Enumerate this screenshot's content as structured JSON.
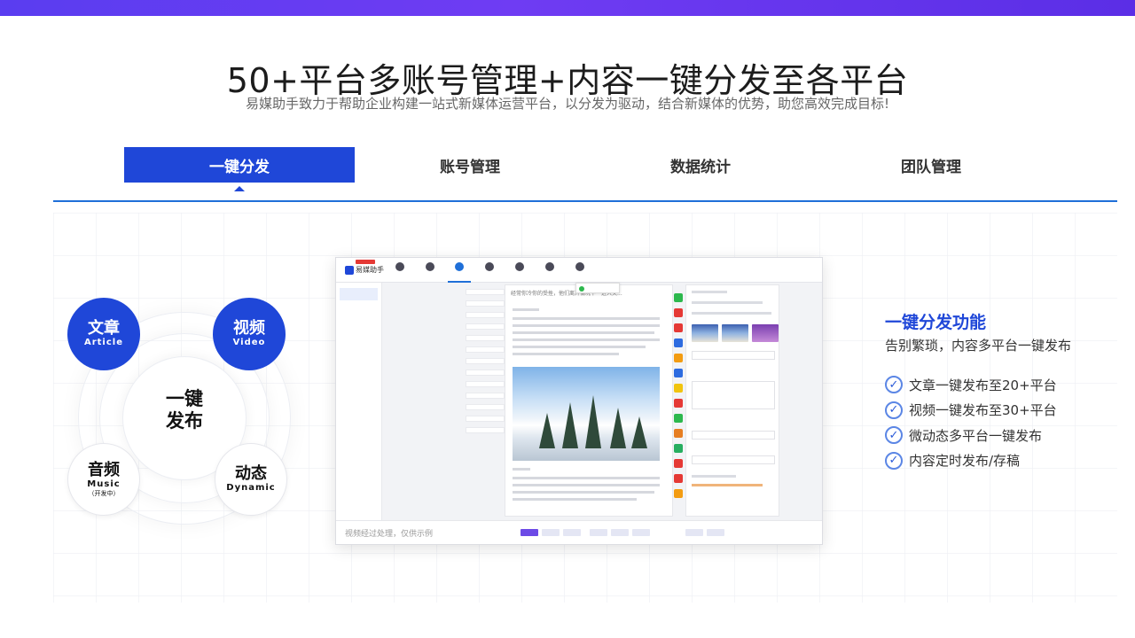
{
  "header": {
    "title": "50+平台多账号管理+内容一键分发至各平台",
    "subtitle": "易媒助手致力于帮助企业构建一站式新媒体运营平台，以分发为驱动，结合新媒体的优势，助您高效完成目标!"
  },
  "tabs": [
    {
      "label": "一键分发",
      "active": true
    },
    {
      "label": "账号管理",
      "active": false
    },
    {
      "label": "数据统计",
      "active": false
    },
    {
      "label": "团队管理",
      "active": false
    }
  ],
  "diagram": {
    "center": [
      "一键",
      "发布"
    ],
    "bubbles": {
      "article": {
        "cn": "文章",
        "en": "Article"
      },
      "video": {
        "cn": "视频",
        "en": "Video"
      },
      "music": {
        "cn": "音频",
        "en": "Music",
        "note": "（开发中）"
      },
      "dynamic": {
        "cn": "动态",
        "en": "Dynamic"
      }
    }
  },
  "screenshot": {
    "caption": "视频经过处理，仅供示例",
    "app_name": "易媒助手",
    "editor_title": "经常你冷你的受挫，他们离开情况下一进入关..."
  },
  "feature": {
    "title": "一键分发功能",
    "description": "告别繁琐，内容多平台一键发布",
    "items": [
      "文章一键发布至20+平台",
      "视频一键发布至30+平台",
      "微动态多平台一键发布",
      "内容定时发布/存稿"
    ]
  },
  "colors": {
    "accent": "#1f47d8",
    "top_gradient_start": "#5a3df0",
    "top_gradient_end": "#5b2ee6",
    "divider": "#1f6fd8"
  },
  "icons": {
    "check": "check-circle-icon"
  }
}
